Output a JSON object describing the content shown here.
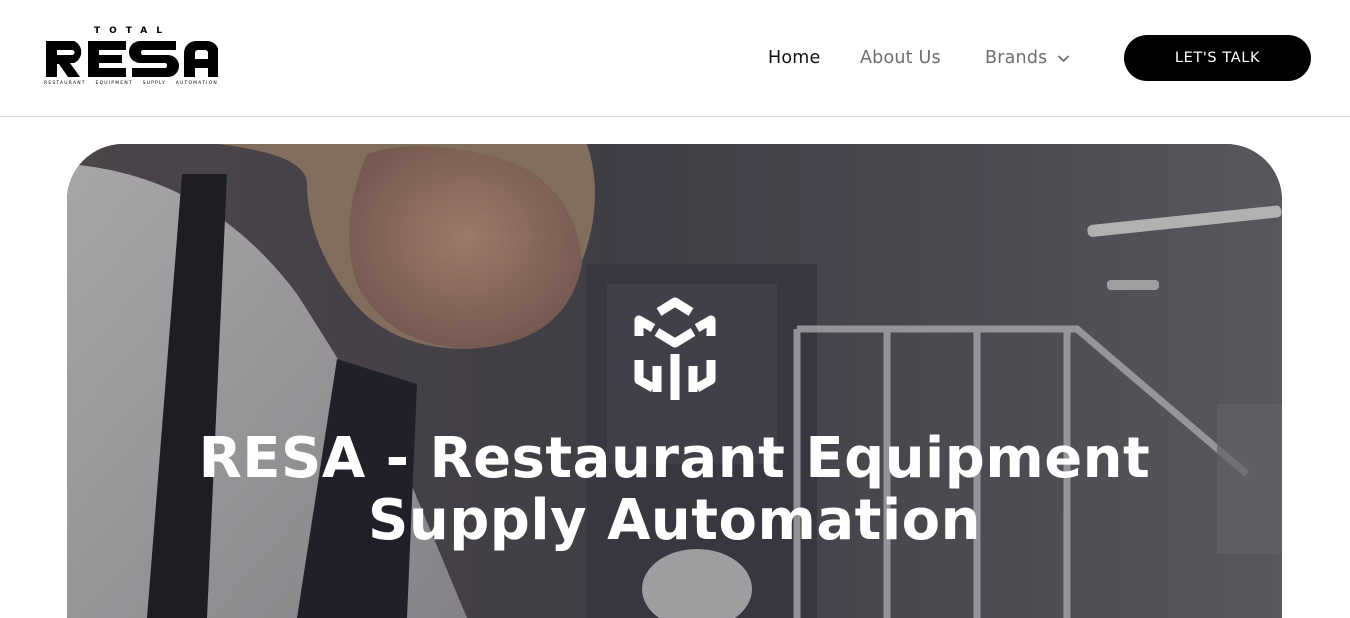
{
  "brand": {
    "top_word": "TOTAL",
    "name": "RESA",
    "tagline": [
      "RESTAURANT",
      "EQUIPMENT",
      "SUPPLY",
      "AUTOMATION"
    ]
  },
  "nav": {
    "items": [
      {
        "label": "Home",
        "active": true
      },
      {
        "label": "About Us",
        "active": false
      },
      {
        "label": "Brands",
        "active": false,
        "has_dropdown": true
      }
    ],
    "cta_label": "LET'S TALK"
  },
  "hero": {
    "title_line1": "RESA - Restaurant Equipment",
    "title_line2": "Supply Automation",
    "emblem_icon": "resa-cube-icon"
  },
  "colors": {
    "text_dark": "#111111",
    "nav_muted": "#6f6f6f",
    "cta_bg": "#000000",
    "cta_text": "#ffffff",
    "hero_text": "#ffffff"
  }
}
